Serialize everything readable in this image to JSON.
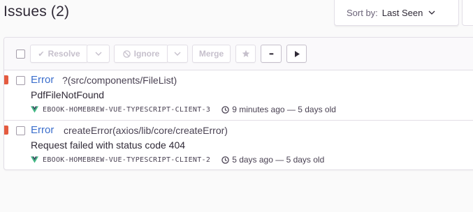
{
  "header": {
    "title": "Issues (2)",
    "sort_label": "Sort by:",
    "sort_value": "Last Seen"
  },
  "toolbar": {
    "resolve_label": "Resolve",
    "ignore_label": "Ignore",
    "merge_label": "Merge",
    "more_label": "•••"
  },
  "issues": [
    {
      "type": "Error",
      "location": "?(src/components/FileList)",
      "message": "PdfFileNotFound",
      "project": "EBOOK-HOMEBREW-VUE-TYPESCRIPT-CLIENT-3",
      "time": "9 minutes ago — 5 days old"
    },
    {
      "type": "Error",
      "location": "createError(axios/lib/core/createError)",
      "message": "Request failed with status code 404",
      "project": "EBOOK-HOMEBREW-VUE-TYPESCRIPT-CLIENT-2",
      "time": "5 days ago — 5 days old"
    }
  ],
  "colors": {
    "level_error": "#e45b3f",
    "link": "#3b6ecc",
    "vue_green": "#41b883",
    "vue_dark": "#35495e"
  }
}
